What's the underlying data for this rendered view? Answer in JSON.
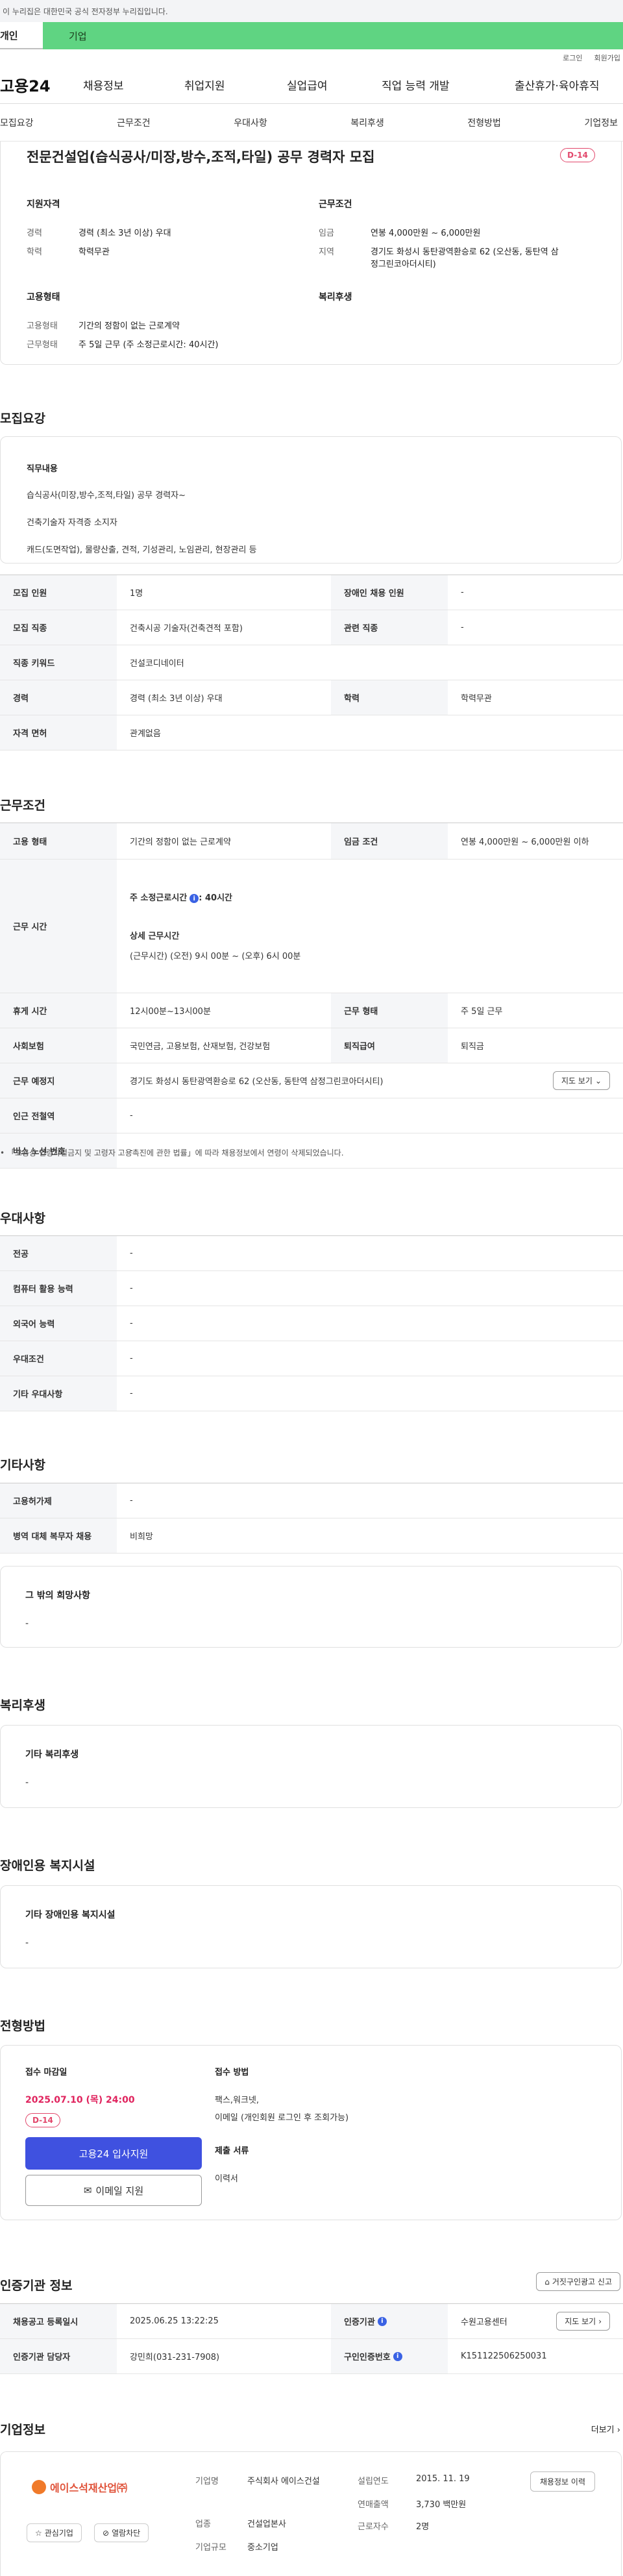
{
  "gov_banner": "이 누리집은 대한민국 공식 전자정부 누리집입니다.",
  "category_tabs": [
    "개인",
    "기업"
  ],
  "util": {
    "login": "로그인",
    "join": "회원가입"
  },
  "gnb": {
    "logo": "고용24",
    "items": [
      "채용정보",
      "취업지원",
      "실업급여",
      "직업 능력 개발",
      "출산휴가·육아휴직"
    ]
  },
  "subnav": [
    "모집요강",
    "근무조건",
    "우대사항",
    "복리후생",
    "전형방법",
    "기업정보"
  ],
  "summary": {
    "title": "전문건설업(습식공사/미장,방수,조적,타일) 공무 경력자 모집",
    "dday": "D-14",
    "qual_title": "지원자격",
    "qual": [
      {
        "k": "경력",
        "v": "경력 (최소 3년 이상) 우대"
      },
      {
        "k": "학력",
        "v": "학력무관"
      }
    ],
    "work_title": "근무조건",
    "work": [
      {
        "k": "임금",
        "v": "연봉 4,000만원 ~ 6,000만원"
      },
      {
        "k": "지역",
        "v": "경기도 화성시 동탄광역환승로 62 (오산동, 동탄역 삼정그린코아더시티)"
      }
    ],
    "emp_title": "고용형태",
    "emp": [
      {
        "k": "고용형태",
        "v": "기간의 정함이 없는 근로계약"
      },
      {
        "k": "근무형태",
        "v": "주 5일 근무 (주 소정근로시간: 40시간)"
      }
    ],
    "welfare_title": "복리후생"
  },
  "recruit": {
    "heading": "모집요강",
    "duty_title": "직무내용",
    "duty_lines": [
      "습식공사(미장,방수,조적,타일) 공무 경력자~",
      "건축기술자 자격증 소지자",
      "캐드(도면작업), 물량산출, 견적, 기성관리, 노임관리, 현장관리 등"
    ],
    "rows": [
      {
        "k1": "모집 인원",
        "v1": "1명",
        "k2": "장애인 채용 인원",
        "v2": "-"
      },
      {
        "k1": "모집 직종",
        "v1": "건축시공 기술자(건축견적 포함)",
        "k2": "관련 직종",
        "v2": "-"
      },
      {
        "k1": "직종 키워드",
        "v1": "건설코디네이터"
      },
      {
        "k1": "경력",
        "v1": "경력 (최소 3년 이상) 우대",
        "k2": "학력",
        "v2": "학력무관"
      },
      {
        "k1": "자격 면허",
        "v1": "관계없음"
      }
    ]
  },
  "conditions": {
    "heading": "근무조건",
    "emp_type_k": "고용 형태",
    "emp_type_v": "기간의 정함이 없는 근로계약",
    "wage_k": "임금 조건",
    "wage_v": "연봉 4,000만원 ~ 6,000만원 이하",
    "hours_k": "근무 시간",
    "hours_weekly_label": "주 소정근로시간",
    "hours_weekly_val": ": 40시간",
    "hours_detail_title": "상세 근무시간",
    "hours_detail": "(근무시간) (오전) 9시 00분 ~ (오후) 6시 00분",
    "break_k": "휴게 시간",
    "break_v": "12시00분~13시00분",
    "worktype_k": "근무 형태",
    "worktype_v": "주 5일 근무",
    "insurance_k": "사회보험",
    "insurance_v": "국민연금, 고용보험, 산재보험, 건강보험",
    "severance_k": "퇴직급여",
    "severance_v": "퇴직금",
    "place_k": "근무 예정지",
    "place_v": "경기도 화성시 동탄광역환승로 62 (오산동, 동탄역 삼정그린코아더시티)",
    "map_btn": "지도 보기",
    "subway_k": "인근 전철역",
    "subway_v": "-",
    "bus_k": "버스 노선 번호",
    "bus_v": "-",
    "note": "「고용상 연령차별금지 및 고령자 고용촉진에 관한 법률」에 따라 채용정보에서 연령이 삭제되었습니다."
  },
  "preference": {
    "heading": "우대사항",
    "rows": [
      {
        "k": "전공",
        "v": "-"
      },
      {
        "k": "컴퓨터 활용 능력",
        "v": "-"
      },
      {
        "k": "외국어 능력",
        "v": "-"
      },
      {
        "k": "우대조건",
        "v": "-"
      },
      {
        "k": "기타 우대사항",
        "v": "-"
      }
    ]
  },
  "other": {
    "heading": "기타사항",
    "rows": [
      {
        "k": "고용허가제",
        "v": "-"
      },
      {
        "k": "병역 대체 복무자 채용",
        "v": "비희망"
      }
    ],
    "box_title": "그 밖의 희망사항",
    "box_value": "-"
  },
  "welfare": {
    "heading": "복리후생",
    "box_title": "기타 복리후생",
    "box_value": "-"
  },
  "disability": {
    "heading": "장애인용 복지시설",
    "box_title": "기타 장애인용 복지시설",
    "box_value": "-"
  },
  "process": {
    "heading": "전형방법",
    "deadline_title": "접수 마감일",
    "deadline": "2025.07.10 (목) 24:00",
    "dday": "D-14",
    "apply_btn": "고용24 입사지원",
    "email_btn": "이메일 지원",
    "method_title": "접수 방법",
    "method_lines": [
      "팩스,워크넷,",
      "이메일 (개인회원 로그인 후 조회가능)"
    ],
    "docs_title": "제출 서류",
    "docs": "이력서"
  },
  "agency": {
    "heading": "인증기관 정보",
    "report_btn": "거짓구인광고 신고",
    "reg_date_k": "채용공고 등록일시",
    "reg_date_v": "2025.06.25 13:22:25",
    "org_k": "인증기관",
    "org_v": "수원고용센터",
    "map_btn": "지도 보기",
    "manager_k": "인증기관 담당자",
    "manager_v": "강민희(031-231-7908)",
    "job_no_k": "구인인증번호",
    "job_no_v": "K151122506250031"
  },
  "company": {
    "heading": "기업정보",
    "more": "더보기",
    "logo_text": "에이스석재산업㈜",
    "fav_btn": "관심기업",
    "block_btn": "열람차단",
    "name_k": "기업명",
    "name_v": "주식회사 에이스건설",
    "industry_k": "업종",
    "industry_v": "건설업본사",
    "size_k": "기업규모",
    "size_v": "중소기업",
    "founded_k": "설립연도",
    "founded_v": "2015. 11. 19",
    "sales_k": "연매출액",
    "sales_v": "3,730 백만원",
    "staff_k": "근로자수",
    "staff_v": "2명",
    "history_btn": "채용정보 이력"
  },
  "colors": {
    "green": "#5fd482",
    "accent": "#3f51e0",
    "dday": "#e2476b",
    "deadline": "#e0245e",
    "info": "#3a62e4"
  }
}
